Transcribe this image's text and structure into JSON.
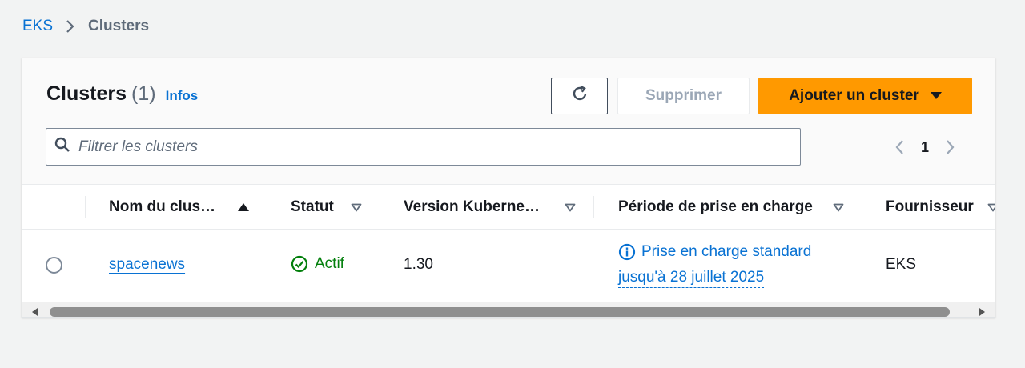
{
  "breadcrumb": {
    "root": "EKS",
    "current": "Clusters"
  },
  "panel": {
    "title": "Clusters",
    "count": "(1)",
    "info_link": "Infos",
    "delete_label": "Supprimer",
    "add_label": "Ajouter un cluster",
    "filter_placeholder": "Filtrer les clusters",
    "page_number": "1"
  },
  "table": {
    "columns": [
      {
        "label": "Nom du clus…",
        "sort": "ascending"
      },
      {
        "label": "Statut",
        "sort": "none"
      },
      {
        "label": "Version Kuberne…",
        "sort": "none"
      },
      {
        "label": "Période de prise en charge",
        "sort": "none"
      },
      {
        "label": "Fournisseur",
        "sort": "none"
      }
    ],
    "rows": [
      {
        "name": "spacenews",
        "status": "Actif",
        "version": "1.30",
        "support_line1": "Prise en charge standard",
        "support_line2": "jusqu'à 28 juillet 2025",
        "provider": "EKS"
      }
    ]
  },
  "colors": {
    "link": "#0972d3",
    "primary_button": "#ff9900",
    "status_active": "#037f0c",
    "text": "#16191f",
    "muted": "#5f6b7a"
  },
  "icons": [
    "chevron-right-icon",
    "refresh-icon",
    "caret-down-icon",
    "search-icon",
    "chevron-left-icon",
    "sort-ascending-icon",
    "sort-descending-icon",
    "status-check-icon",
    "info-icon"
  ]
}
